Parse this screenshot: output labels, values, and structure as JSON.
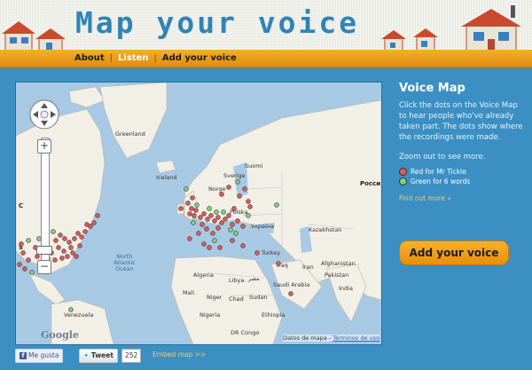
{
  "header": {
    "title": "Map your voice",
    "nav": {
      "about": "About",
      "listen": "Listen",
      "add": "Add your voice",
      "separator": "|"
    }
  },
  "map": {
    "labels": {
      "greenland": "Greenland",
      "iceland": "Iceland",
      "norway": "Norge",
      "sweden": "Sverige",
      "finland": "Suomi",
      "russia": "Росси",
      "kazakhstan": "Kazakhstan",
      "ukraine": "Україна",
      "poland": "Polska",
      "turkey": "Turkey",
      "iraq": "Iraq",
      "iran": "Iran",
      "afghanistan": "Afghanistan",
      "pakistan": "Pakistan",
      "india": "India",
      "saudi": "Saudi Arabia",
      "egypt": "مصر",
      "libya": "Libya",
      "algeria": "Algeria",
      "mali": "Mali",
      "niger": "Niger",
      "chad": "Chad",
      "sudan": "Sudan",
      "ethiopia": "Ethiopia",
      "nigeria": "Nigeria",
      "drc": "DR Congo",
      "atlantic": "North\nAtlantic\nOcean",
      "venezuela": "Venezuela",
      "canada_edge": "C",
      "usa_edge": "S"
    },
    "attribution_prefix": "Datos de mapa",
    "attribution_link": "Términos de uso",
    "google": "Google",
    "zoom_in": "+",
    "zoom_out": "−"
  },
  "panel": {
    "title": "Voice Map",
    "intro": "Click the dots on the Voice Map to hear people who've already taken part. The dots show where the recordings were made.",
    "zoom_hint": "Zoom out to see more.",
    "legend": [
      {
        "label": "Red for Mr Tickle",
        "color": "#e8575a"
      },
      {
        "label": "Green for 6 words",
        "color": "#7ed47a"
      }
    ],
    "find_more": "Find out more »",
    "add_button": "Add your voice"
  },
  "footer": {
    "like": "Me gusta",
    "tweet": "Tweet",
    "tweet_count": "252",
    "embed": "Embed map >>"
  },
  "colors": {
    "bg": "#3b8fc3",
    "accent": "#f0a020",
    "title": "#2f84b6",
    "land": "#f2efe6",
    "water": "#a7c9e4"
  }
}
